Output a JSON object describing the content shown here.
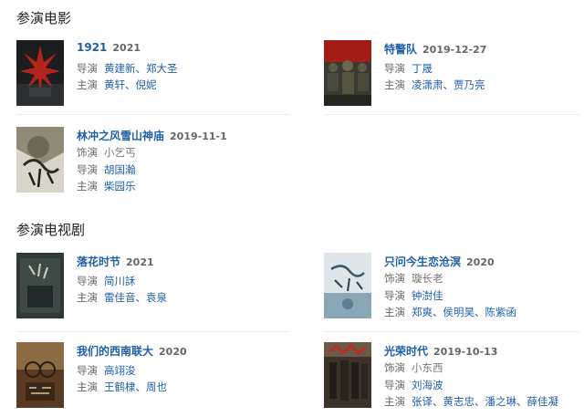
{
  "sections": {
    "movies_title": "参演电影",
    "tv_title": "参演电视剧"
  },
  "movies": [
    {
      "title": "1921",
      "date": "2021",
      "rows": [
        {
          "label": "导演",
          "people": [
            "黄建新",
            "郑大圣"
          ]
        },
        {
          "label": "主演",
          "people": [
            "黄轩",
            "倪妮"
          ]
        }
      ]
    },
    {
      "title": "特警队",
      "date": "2019-12-27",
      "rows": [
        {
          "label": "导演",
          "people": [
            "丁晟"
          ]
        },
        {
          "label": "主演",
          "people": [
            "凌潇肃",
            "贾乃亮"
          ]
        }
      ]
    },
    {
      "title": "林冲之风雪山神庙",
      "date": "2019-11-1",
      "rows": [
        {
          "label": "饰演",
          "role": "小乞丐"
        },
        {
          "label": "导演",
          "people": [
            "胡国瀚"
          ]
        },
        {
          "label": "主演",
          "people": [
            "柴园乐"
          ]
        }
      ]
    }
  ],
  "tv": [
    {
      "title": "落花时节",
      "date": "2021",
      "rows": [
        {
          "label": "导演",
          "people": [
            "简川訸"
          ]
        },
        {
          "label": "主演",
          "people": [
            "雷佳音",
            "袁泉"
          ]
        }
      ]
    },
    {
      "title": "只问今生恋沧溟",
      "date": "2020",
      "rows": [
        {
          "label": "饰演",
          "role": "璇长老"
        },
        {
          "label": "导演",
          "people": [
            "钟澍佳"
          ]
        },
        {
          "label": "主演",
          "people": [
            "郑爽",
            "侯明昊",
            "陈紫函"
          ]
        }
      ]
    },
    {
      "title": "我们的西南联大",
      "date": "2020",
      "rows": [
        {
          "label": "导演",
          "people": [
            "高翊浚"
          ]
        },
        {
          "label": "主演",
          "people": [
            "王鹤棣",
            "周也"
          ]
        }
      ]
    },
    {
      "title": "光荣时代",
      "date": "2019-10-13",
      "rows": [
        {
          "label": "饰演",
          "role": "小东西"
        },
        {
          "label": "导演",
          "people": [
            "刘海波"
          ]
        },
        {
          "label": "主演",
          "people": [
            "张译",
            "黄志忠",
            "潘之琳",
            "薛佳凝"
          ]
        }
      ]
    }
  ]
}
